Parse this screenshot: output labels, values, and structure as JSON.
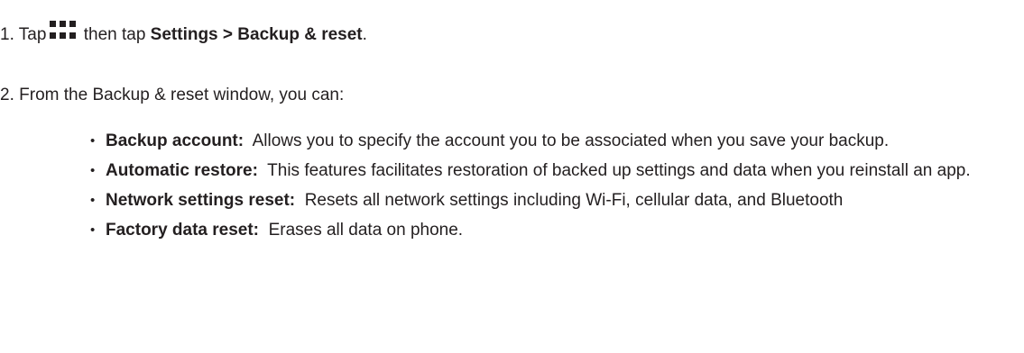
{
  "steps": {
    "step1": {
      "number": "1.",
      "tap": "Tap",
      "then_tap": "then tap",
      "path_part1": "Settings",
      "separator": ">",
      "path_part2": "Backup & reset",
      "end": "."
    },
    "step2": {
      "number": "2.",
      "text": "From the Backup & reset window, you can:"
    }
  },
  "icons": {
    "apps": "apps-grid-icon",
    "color": "#231f20"
  },
  "bullets": [
    {
      "term": "Backup account:",
      "desc": "Allows you to specify the account you to be associated when you save your backup."
    },
    {
      "term": "Automatic restore:",
      "desc": "This features facilitates restoration of backed up settings and data when you reinstall an app."
    },
    {
      "term": "Network settings reset:",
      "desc": "Resets all network settings including Wi-Fi, cellular data, and Bluetooth"
    },
    {
      "term": "Factory data reset:",
      "desc": "Erases all data on phone."
    }
  ]
}
